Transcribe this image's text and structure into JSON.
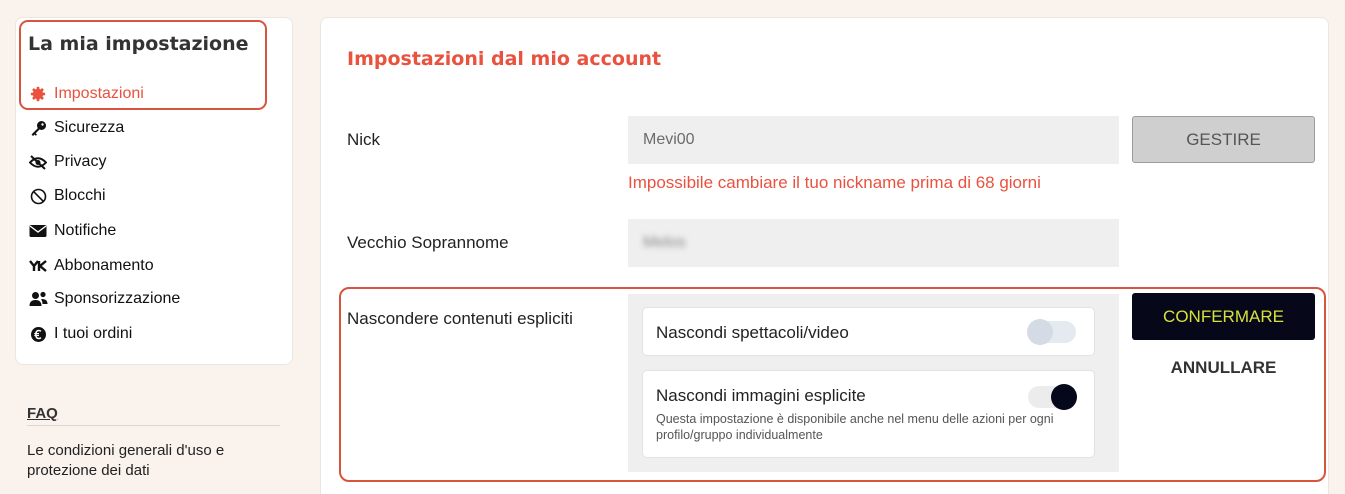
{
  "sidebar": {
    "title": "La mia impostazione",
    "items": [
      {
        "label": "Impostazioni",
        "icon": "gear-icon",
        "active": true
      },
      {
        "label": "Sicurezza",
        "icon": "key-icon"
      },
      {
        "label": "Privacy",
        "icon": "eye-slash-icon"
      },
      {
        "label": "Blocchi",
        "icon": "ban-icon"
      },
      {
        "label": "Notifiche",
        "icon": "envelope-icon"
      },
      {
        "label": "Abbonamento",
        "icon": "subscription-logo-icon"
      },
      {
        "label": "Sponsorizzazione",
        "icon": "users-icon"
      },
      {
        "label": "I tuoi ordini",
        "icon": "euro-coin-icon"
      }
    ],
    "faq": "FAQ",
    "legal": "Le condizioni generali d'uso e protezione dei dati"
  },
  "main": {
    "title": "Impostazioni dal mio account",
    "nick": {
      "label": "Nick",
      "value": "Mevi00",
      "button": "GESTIRE",
      "error": "Impossibile cambiare il tuo nickname prima di 68 giorni"
    },
    "old_nick": {
      "label": "Vecchio Soprannome",
      "value": "Melos"
    },
    "explicit": {
      "label": "Nascondere contenuti espliciti",
      "options": [
        {
          "label": "Nascondi spettacoli/video",
          "enabled": false
        },
        {
          "label": "Nascondi immagini esplicite",
          "enabled": true,
          "description": "Questa impostazione è disponibile anche nel menu delle azioni per ogni profilo/gruppo individualmente"
        }
      ],
      "confirm": "CONFERMARE",
      "cancel": "ANNULLARE"
    }
  },
  "colors": {
    "accent": "#e8523f",
    "highlight_border": "#d9543f",
    "confirm_bg": "#06081a",
    "confirm_text": "#d6e23a",
    "background": "#f9f2ed"
  }
}
